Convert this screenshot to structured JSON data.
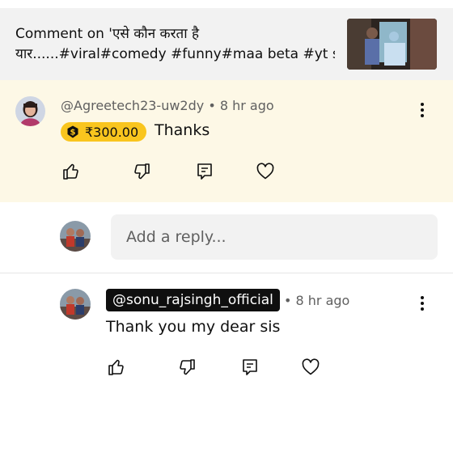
{
  "header": {
    "title_line1": "Comment on 'एसे कौन करता है",
    "title_line2": "यार......#viral#comedy #funny#maa beta #yt sh..."
  },
  "comment": {
    "author": "@Agreetech23-uw2dy",
    "time": "• 8 hr ago",
    "super_thanks_amount": "₹300.00",
    "text": "Thanks"
  },
  "reply_input": {
    "placeholder": "Add a reply..."
  },
  "reply": {
    "author": "@sonu_rajsingh_official",
    "time": "• 8 hr ago",
    "text": "Thank you my dear sis"
  },
  "icons": {
    "like": "thumb-up-icon",
    "dislike": "thumb-down-icon",
    "reply": "reply-icon",
    "heart": "heart-icon",
    "more": "more-vert-icon",
    "super_thanks": "super-thanks-icon"
  },
  "colors": {
    "highlight_bg": "#fdf8e6",
    "super_thanks_chip": "#f9c51e",
    "header_bg": "#f2f2f2"
  }
}
